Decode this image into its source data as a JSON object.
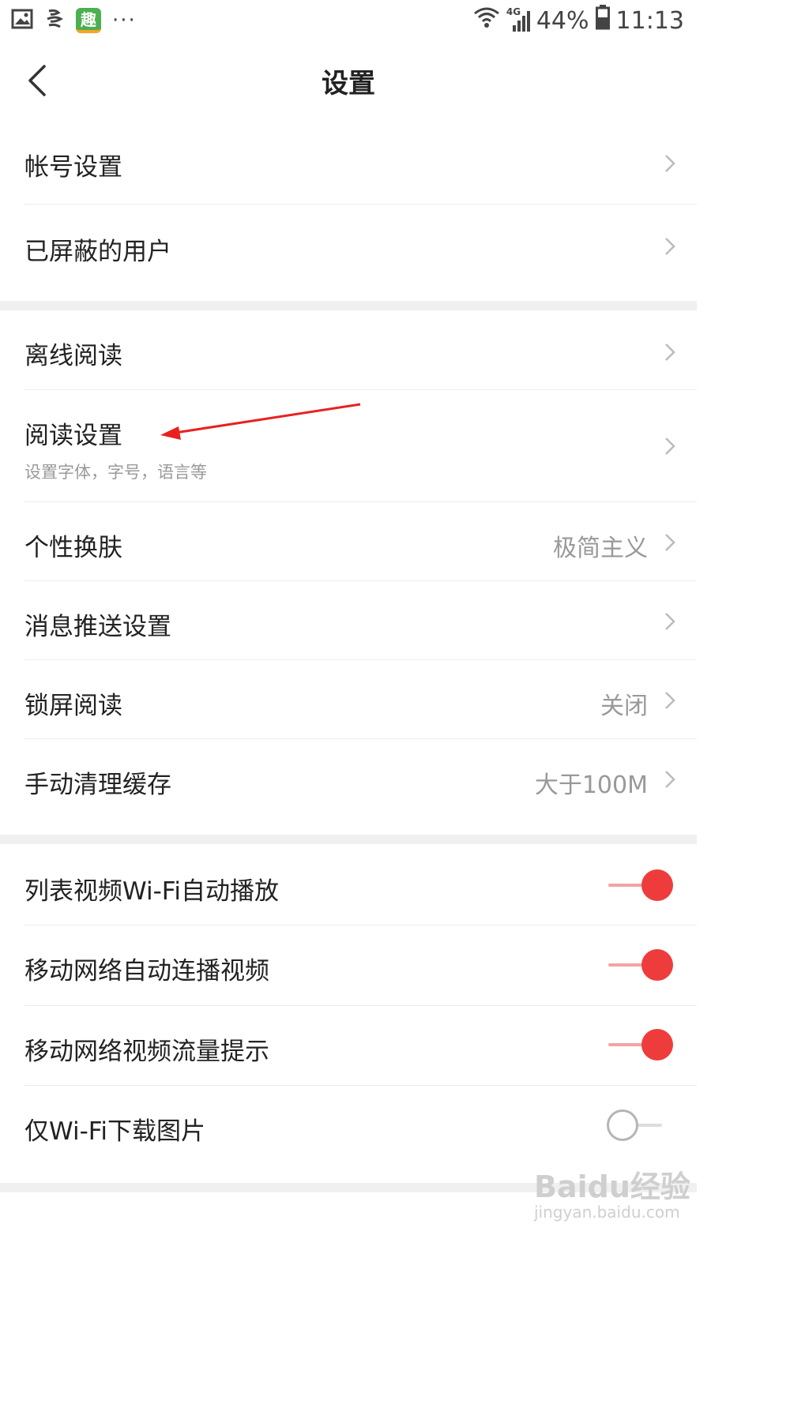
{
  "status_bar": {
    "battery": "44%",
    "time": "11:13",
    "network": "4G",
    "app_badge": "趣",
    "overflow": "···"
  },
  "header": {
    "title": "设置",
    "back_icon": "chevron-left-icon"
  },
  "groups": [
    {
      "items": [
        {
          "label": "帐号设置"
        },
        {
          "label": "已屏蔽的用户"
        }
      ]
    },
    {
      "items": [
        {
          "label": "离线阅读"
        },
        {
          "label": "阅读设置",
          "subtitle": "设置字体，字号，语言等"
        },
        {
          "label": "个性换肤",
          "value": "极简主义"
        },
        {
          "label": "消息推送设置"
        },
        {
          "label": "锁屏阅读",
          "value": "关闭"
        },
        {
          "label": "手动清理缓存",
          "value": "大于100M"
        }
      ]
    },
    {
      "items": [
        {
          "label": "列表视频Wi-Fi自动播放",
          "toggle": true
        },
        {
          "label": "移动网络自动连播视频",
          "toggle": true
        },
        {
          "label": "移动网络视频流量提示",
          "toggle": true
        },
        {
          "label": "仅Wi-Fi下载图片",
          "toggle": false
        }
      ]
    }
  ],
  "colors": {
    "accent": "#ee3c3c",
    "annotation_arrow": "#e8211e",
    "section_gap": "#f0f0f0"
  },
  "watermark": {
    "main": "Baidu经验",
    "sub": "jingyan.baidu.com"
  }
}
